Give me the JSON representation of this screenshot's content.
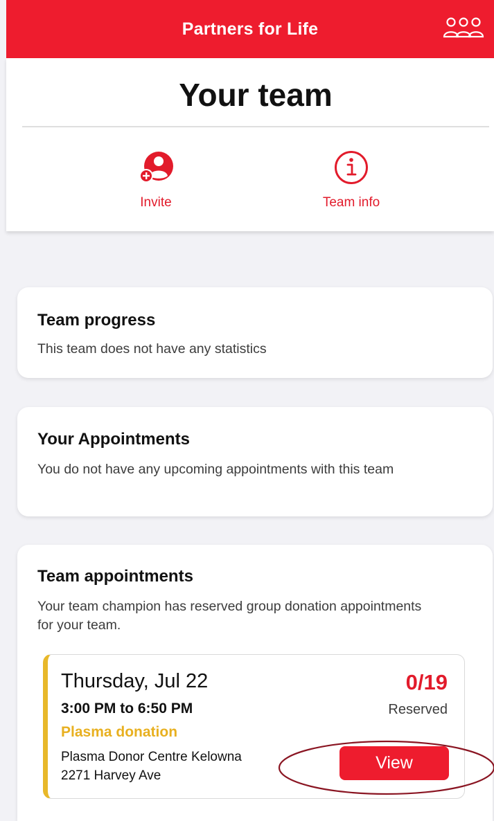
{
  "header": {
    "title": "Partners for Life",
    "team_icon": "group-icon",
    "accent_color": "#ee1c2e"
  },
  "page": {
    "title": "Your team"
  },
  "actions": [
    {
      "label": "Invite",
      "icon": "add-person-icon"
    },
    {
      "label": "Team info",
      "icon": "info-circle-icon"
    }
  ],
  "cards": {
    "team_progress": {
      "title": "Team progress",
      "text": "This team does not have any statistics"
    },
    "your_appointments": {
      "title": "Your Appointments",
      "text": "You do not have any upcoming appointments with this team"
    },
    "team_appointments": {
      "title": "Team appointments",
      "text": "Your team champion has reserved group donation appointments for your team.",
      "appointment": {
        "date": "Thursday, Jul 22",
        "time": "3:00 PM to 6:50 PM",
        "type": "Plasma donation",
        "location_line1": "Plasma Donor Centre Kelowna",
        "location_line2": "2271 Harvey Ave",
        "count": "0/19",
        "status": "Reserved",
        "button_label": "View",
        "type_color": "#e8b020"
      }
    }
  }
}
